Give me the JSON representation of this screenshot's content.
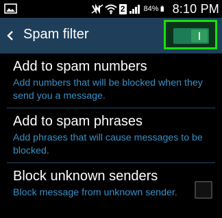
{
  "status_bar": {
    "sim_slot": "2",
    "battery_percent": "84%",
    "time": "8:10 PM",
    "icons": [
      "image-notification-icon",
      "mute-icon",
      "wifi-icon",
      "sim-icon",
      "signal-icon",
      "battery-icon"
    ]
  },
  "action_bar": {
    "title": "Spam filter",
    "toggle_state": "on",
    "highlight_color": "#19e012"
  },
  "items": [
    {
      "title": "Add to spam numbers",
      "description": "Add numbers that will be blocked when they send you a message."
    },
    {
      "title": "Add to spam phrases",
      "description": "Add phrases that will cause messages to be blocked."
    },
    {
      "title": "Block unknown senders",
      "description": "Block message from unknown sender.",
      "checked": false
    }
  ],
  "colors": {
    "action_bar_bg": "#1f3e5a",
    "description_text": "#3a8fc6",
    "toggle_on": "#2e9d5f"
  }
}
